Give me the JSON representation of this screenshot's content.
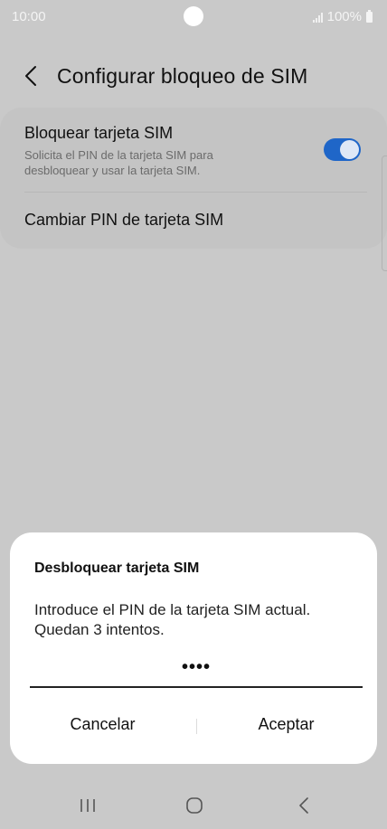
{
  "status_bar": {
    "time": "10:00",
    "battery": "100%"
  },
  "header": {
    "title": "Configurar bloqueo de SIM"
  },
  "settings": {
    "lock_sim_title": "Bloquear tarjeta SIM",
    "lock_sim_description": "Solicita el PIN de la tarjeta SIM para desbloquear y usar la tarjeta SIM.",
    "lock_sim_enabled": true,
    "change_pin_label": "Cambiar PIN de tarjeta SIM"
  },
  "dialog": {
    "title": "Desbloquear tarjeta SIM",
    "message": "Introduce el PIN de la tarjeta SIM actual. Quedan 3 intentos.",
    "pin_value": "••••",
    "cancel_label": "Cancelar",
    "accept_label": "Aceptar"
  },
  "colors": {
    "accent": "#1f66c8",
    "background_dim": "#c9c9c9"
  },
  "icons": {
    "back": "back-arrow-icon",
    "recents": "recents-icon",
    "home": "home-icon",
    "nav_back": "nav-back-icon"
  }
}
